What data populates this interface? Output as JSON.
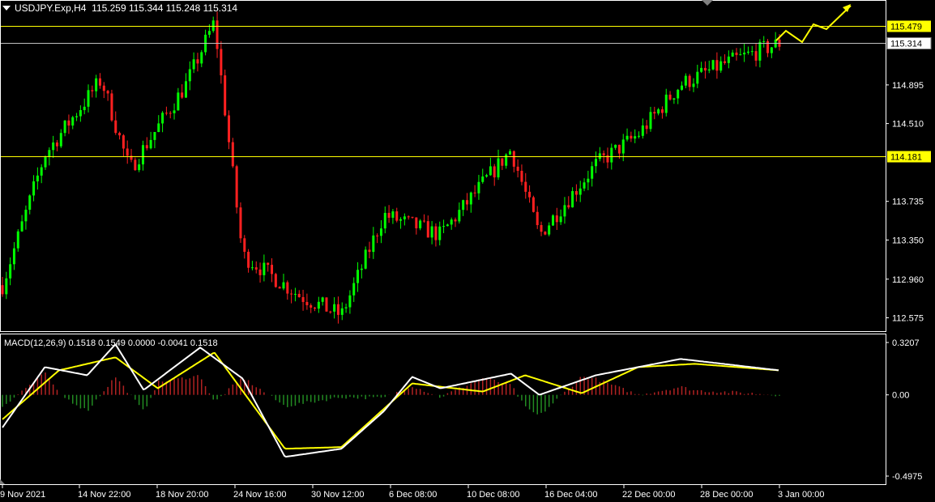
{
  "header": {
    "symbol": "USDJPY.Exp,H4",
    "ohlc": "115.259 115.344 115.248 115.314"
  },
  "macd": {
    "label": "MACD(12,26,9) 0.1518 0.1549 0.0000 -0.0041 0.1518",
    "ticks": [
      "0.3207",
      "0.00",
      "-0.4975"
    ]
  },
  "price_axis": {
    "ticks": [
      "114.895",
      "114.510",
      "113.735",
      "113.350",
      "112.960",
      "112.575"
    ]
  },
  "levels": [
    {
      "label": "115.479",
      "color": "#ffff00"
    },
    {
      "label": "115.314",
      "color": "#c0c0c0"
    },
    {
      "label": "114.181",
      "color": "#ffff00"
    }
  ],
  "time_axis": {
    "ticks": [
      "9 Nov 2021",
      "14 Nov 22:00",
      "18 Nov 20:00",
      "24 Nov 16:00",
      "30 Nov 12:00",
      "6 Dec 08:00",
      "10 Dec 08:00",
      "16 Dec 04:00",
      "22 Dec 00:00",
      "28 Dec 00:00",
      "3 Jan 00:00"
    ]
  },
  "colors": {
    "bull": "#00ff00",
    "bear": "#ff2020",
    "macd_line": "#ffffff",
    "signal_line": "#ffff00",
    "hist_pos": "#b22222",
    "hist_neg": "#228b22",
    "annotation": "#ffff00"
  },
  "chart_data": {
    "type": "candlestick",
    "symbol": "USDJPY",
    "timeframe": "H4",
    "ylim": [
      112.45,
      115.62
    ],
    "key_points": [
      {
        "x": "9 Nov 2021",
        "y": 112.9
      },
      {
        "x": "12 Nov 2021",
        "y": 114.2
      },
      {
        "x": "16 Nov 2021",
        "y": 114.95
      },
      {
        "x": "18 Nov 2021",
        "y": 114.05
      },
      {
        "x": "22 Nov 2021",
        "y": 114.9
      },
      {
        "x": "24 Nov 2021",
        "y": 115.52
      },
      {
        "x": "26 Nov 2021",
        "y": 113.2
      },
      {
        "x": "30 Nov 2021",
        "y": 112.8
      },
      {
        "x": "3 Dec 2021",
        "y": 112.6
      },
      {
        "x": "6 Dec 2021",
        "y": 113.6
      },
      {
        "x": "10 Dec 2021",
        "y": 113.4
      },
      {
        "x": "15 Dec 2021",
        "y": 114.25
      },
      {
        "x": "17 Dec 2021",
        "y": 113.4
      },
      {
        "x": "21 Dec 2021",
        "y": 114.1
      },
      {
        "x": "24 Dec 2021",
        "y": 114.4
      },
      {
        "x": "27 Dec 2021",
        "y": 114.9
      },
      {
        "x": "30 Dec 2021",
        "y": 115.1
      },
      {
        "x": "3 Jan 2022",
        "y": 115.31
      }
    ],
    "macd": {
      "ylim": [
        -0.4975,
        0.3207
      ],
      "macd_line_points": [
        {
          "x": "9 Nov 2021",
          "y": -0.2
        },
        {
          "x": "12 Nov 2021",
          "y": 0.17
        },
        {
          "x": "15 Nov 2021",
          "y": 0.12
        },
        {
          "x": "17 Nov 2021",
          "y": 0.31
        },
        {
          "x": "19 Nov 2021",
          "y": 0.03
        },
        {
          "x": "23 Nov 2021",
          "y": 0.29
        },
        {
          "x": "26 Nov 2021",
          "y": 0.1
        },
        {
          "x": "29 Nov 2021",
          "y": -0.38
        },
        {
          "x": "3 Dec 2021",
          "y": -0.33
        },
        {
          "x": "6 Dec 2021",
          "y": -0.1
        },
        {
          "x": "8 Dec 2021",
          "y": 0.11
        },
        {
          "x": "10 Dec 2021",
          "y": 0.04
        },
        {
          "x": "15 Dec 2021",
          "y": 0.13
        },
        {
          "x": "17 Dec 2021",
          "y": 0.0
        },
        {
          "x": "21 Dec 2021",
          "y": 0.12
        },
        {
          "x": "27 Dec 2021",
          "y": 0.22
        },
        {
          "x": "3 Jan 2022",
          "y": 0.15
        }
      ],
      "signal_line_points": [
        {
          "x": "9 Nov 2021",
          "y": -0.15
        },
        {
          "x": "13 Nov 2021",
          "y": 0.15
        },
        {
          "x": "17 Nov 2021",
          "y": 0.23
        },
        {
          "x": "20 Nov 2021",
          "y": 0.04
        },
        {
          "x": "24 Nov 2021",
          "y": 0.26
        },
        {
          "x": "29 Nov 2021",
          "y": -0.33
        },
        {
          "x": "3 Dec 2021",
          "y": -0.32
        },
        {
          "x": "8 Dec 2021",
          "y": 0.07
        },
        {
          "x": "13 Dec 2021",
          "y": 0.02
        },
        {
          "x": "16 Dec 2021",
          "y": 0.12
        },
        {
          "x": "20 Dec 2021",
          "y": 0.01
        },
        {
          "x": "24 Dec 2021",
          "y": 0.17
        },
        {
          "x": "28 Dec 2021",
          "y": 0.19
        },
        {
          "x": "3 Jan 2022",
          "y": 0.15
        }
      ]
    }
  }
}
